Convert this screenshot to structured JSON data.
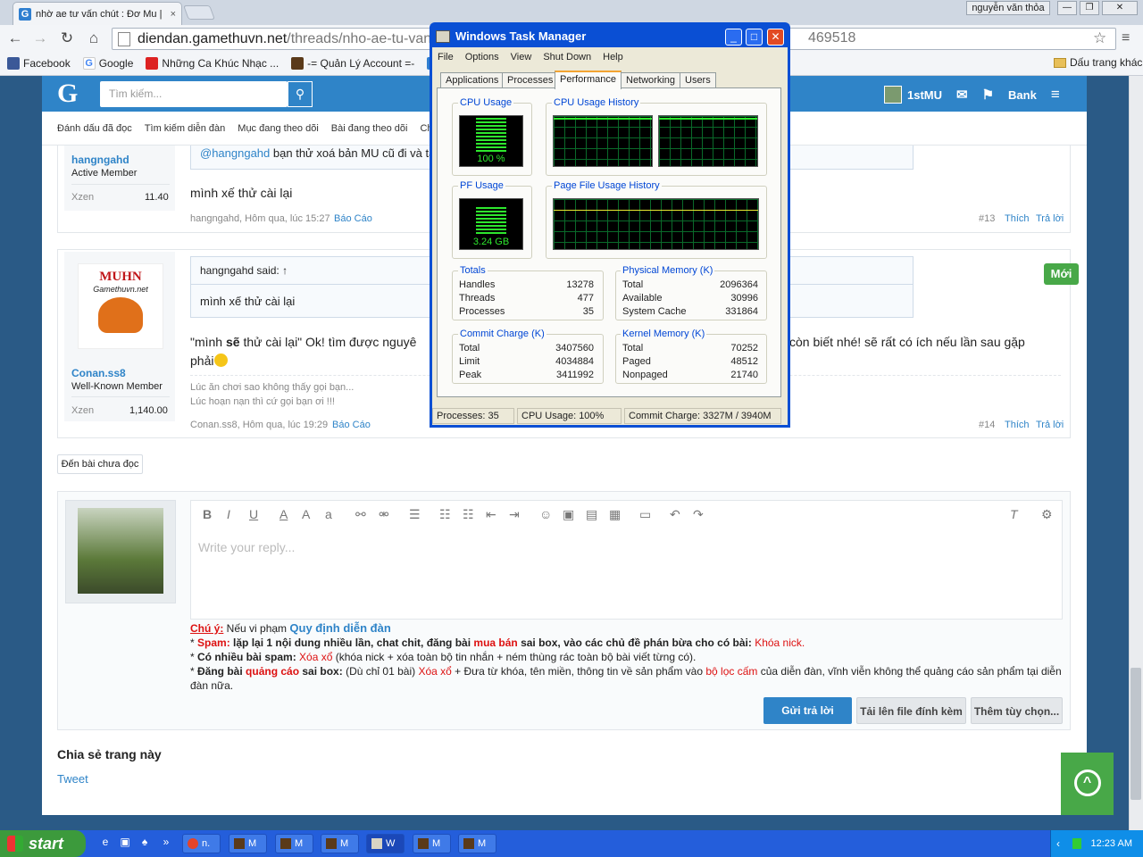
{
  "browser": {
    "tab_title": "nhờ ae tư vấn chút : Đơ Mu |",
    "tab_close": "×",
    "user": "nguyễn văn thỏa",
    "url_host": "diendan.gamethuvn.net",
    "url_path": "/threads/nho-ae-tu-van",
    "url_tail": "469518",
    "bookmarks": [
      "Facebook",
      "Google",
      "Những Ca Khúc Nhạc ...",
      "-= Quản Lý Account =-",
      "Hà"
    ],
    "bookmarks_other": "Dấu trang khác"
  },
  "site": {
    "logo": "G",
    "search_placeholder": "Tìm kiếm...",
    "username": "1stMU",
    "bank": "Bank",
    "subnav": [
      "Đánh dấu đã đọc",
      "Tìm kiếm diễn đàn",
      "Mục đang theo dõi",
      "Bài đang theo dõi",
      "Chú"
    ]
  },
  "post13": {
    "username": "hangngahd",
    "title": "Active Member",
    "stat_label": "Xzen",
    "stat_value": "11.40",
    "quote_mention": "@hangngahd",
    "quote_text": "bạn thử xoá bản MU cũ đi và tả",
    "message": "mình xế thử cài lại",
    "meta": "hangngahd, Hôm qua, lúc 15:27",
    "report": "Báo Cáo",
    "number": "#13",
    "like": "Thích",
    "reply": "Trả lời"
  },
  "post14": {
    "avatar_text": "MUHN",
    "avatar_sub": "Gamethuvn.net",
    "username": "Conan.ss8",
    "title": "Well-Known Member",
    "stat_label": "Xzen",
    "stat_value": "1,140.00",
    "quote_author": "hangngahd said: ↑",
    "quote_text": "mình xế thử cài lại",
    "message_a": "\"mình ",
    "message_b": "sẽ",
    "message_c": " thử cài lại\" Ok! tìm được nguyê",
    "message_d": "còn biết nhé! sẽ rất có ích nếu lần sau gặp",
    "message_e": "phải",
    "sig1": "Lúc ăn chơi sao không thấy gọi bạn...",
    "sig2": "Lúc hoạn nạn thì cứ gọi bạn ơi !!!",
    "meta": "Conan.ss8, Hôm qua, lúc 19:29",
    "report": "Báo Cáo",
    "number": "#14",
    "like": "Thích",
    "reply": "Trả lời",
    "badge": "Mới"
  },
  "unread_button": "Đến bài chưa đọc",
  "reply": {
    "placeholder": "Write your reply...",
    "rules": {
      "note_label": "Chú ý:",
      "note_text": " Nếu vi phạm ",
      "note_link": "Quy định diễn đàn",
      "l1_label": "Spam:",
      "l1_text": " lặp lại 1 nội dung nhiều lần, chat chit, đăng bài ",
      "l1_red": "mua bán",
      "l1_text2": " sai box, vào các chủ đề phán bừa cho có bài: ",
      "l1_end": "Khóa nick.",
      "l2_label": "Có nhiều bài spam:",
      "l2_red": " Xóa xổ",
      "l2_text": " (khóa nick + xóa toàn bộ tin nhắn + ném thùng rác toàn bộ bài viết từng có).",
      "l3_label": "Đăng bài ",
      "l3_red": "quảng cáo",
      "l3_label2": " sai box:",
      "l3_text": " (Dù chỉ 01 bài) ",
      "l3_red2": "Xóa xổ",
      "l3_text2": " + Đưa từ khóa, tên miền, thông tin về sản phẩm vào ",
      "l3_red3": "bộ lọc cấm",
      "l3_text3": " của diễn đàn, vĩnh viễn không thể quảng cáo sản phẩm tại diễn đàn nữa."
    },
    "submit": "Gửi trả lời",
    "upload": "Tải lên file đính kèm",
    "more": "Thêm tùy chọn..."
  },
  "share": {
    "title": "Chia sẻ trang này",
    "tweet": "Tweet"
  },
  "taskmgr": {
    "title": "Windows Task Manager",
    "menu": [
      "File",
      "Options",
      "View",
      "Shut Down",
      "Help"
    ],
    "tabs": [
      "Applications",
      "Processes",
      "Performance",
      "Networking",
      "Users"
    ],
    "active_tab": "Performance",
    "cpu_usage_label": "CPU Usage",
    "cpu_usage_value": "100 %",
    "cpu_fraction": 1.0,
    "cpu_history_label": "CPU Usage History",
    "pf_usage_label": "PF Usage",
    "pf_usage_value": "3.24 GB",
    "pf_fraction": 0.82,
    "pf_history_label": "Page File Usage History",
    "totals": {
      "label": "Totals",
      "handles_k": "Handles",
      "handles": "13278",
      "threads_k": "Threads",
      "threads": "477",
      "processes_k": "Processes",
      "processes": "35"
    },
    "physical": {
      "label": "Physical Memory (K)",
      "total_k": "Total",
      "total": "2096364",
      "available_k": "Available",
      "available": "30996",
      "cache_k": "System Cache",
      "cache": "331864"
    },
    "commit": {
      "label": "Commit Charge (K)",
      "total_k": "Total",
      "total": "3407560",
      "limit_k": "Limit",
      "limit": "4034884",
      "peak_k": "Peak",
      "peak": "3411992"
    },
    "kernel": {
      "label": "Kernel Memory (K)",
      "total_k": "Total",
      "total": "70252",
      "paged_k": "Paged",
      "paged": "48512",
      "nonpaged_k": "Nonpaged",
      "nonpaged": "21740"
    },
    "status": {
      "processes": "Processes: 35",
      "cpu": "CPU Usage: 100%",
      "commit": "Commit Charge: 3327M / 3940M"
    }
  },
  "taskbar": {
    "start": "start",
    "tasks": [
      "n.",
      "M",
      "M",
      "M",
      "W",
      "M",
      "M"
    ],
    "clock": "12:23 AM"
  }
}
